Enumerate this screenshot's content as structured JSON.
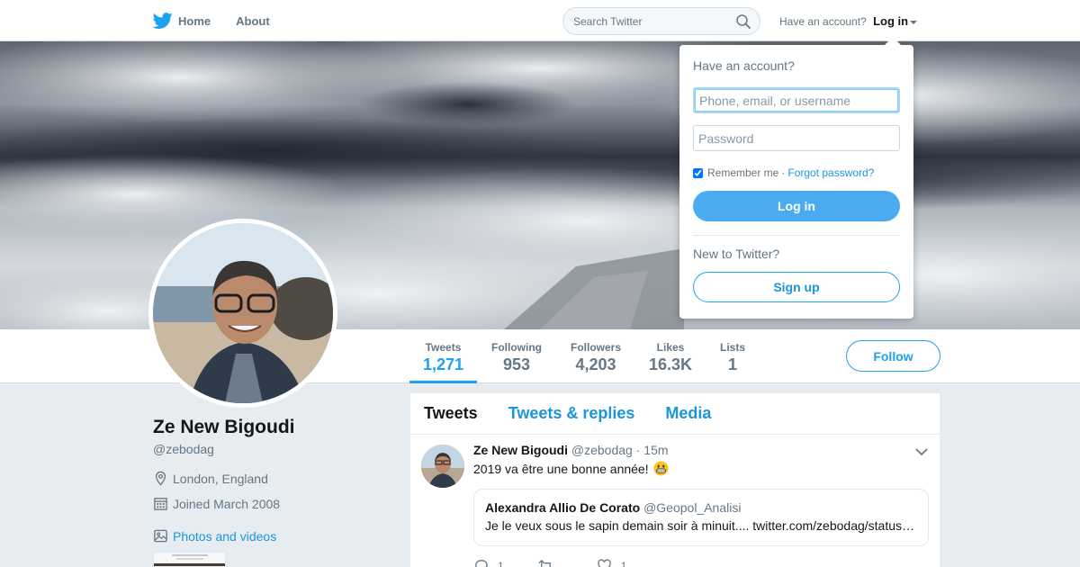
{
  "nav": {
    "home_label": "Home",
    "about_label": "About",
    "search_placeholder": "Search Twitter",
    "have_account_label": "Have an account?",
    "login_label": "Log in",
    "brand_color": "#1da1f2"
  },
  "profile_nav": {
    "stats": [
      {
        "label": "Tweets",
        "value": "1,271",
        "active": true
      },
      {
        "label": "Following",
        "value": "953"
      },
      {
        "label": "Followers",
        "value": "4,203"
      },
      {
        "label": "Likes",
        "value": "16.3K"
      },
      {
        "label": "Lists",
        "value": "1"
      }
    ],
    "follow_label": "Follow"
  },
  "profile": {
    "name": "Ze New Bigoudi",
    "handle": "@zebodag",
    "location": "London, England",
    "joined": "Joined March 2008",
    "photos_label": "Photos and videos",
    "icons": {
      "location": "location-pin-icon",
      "joined": "calendar-icon",
      "photos": "image-icon"
    }
  },
  "timeline": {
    "tabs": [
      {
        "label": "Tweets",
        "active": true
      },
      {
        "label": "Tweets & replies"
      },
      {
        "label": "Media"
      }
    ],
    "tweet": {
      "name": "Ze New Bigoudi",
      "handle": "@zebodag",
      "time": "15m",
      "separator": "·",
      "text": "2019 va être une bonne année!",
      "emoji": "grinning-face-icon",
      "quote": {
        "name": "Alexandra Allio De Corato",
        "handle": "@Geopol_Analisi",
        "text": "Je le veux sous le sapin demain soir à minuit.... twitter.com/zebodag/status…"
      },
      "actions": {
        "reply_count": "1",
        "retweet_count": "",
        "like_count": "1"
      }
    }
  },
  "login_dropdown": {
    "title": "Have an account?",
    "username_placeholder": "Phone, email, or username",
    "password_placeholder": "Password",
    "remember_label": "Remember me",
    "separator": "·",
    "forgot_label": "Forgot password?",
    "login_button": "Log in",
    "new_label": "New to Twitter?",
    "signup_button": "Sign up"
  }
}
